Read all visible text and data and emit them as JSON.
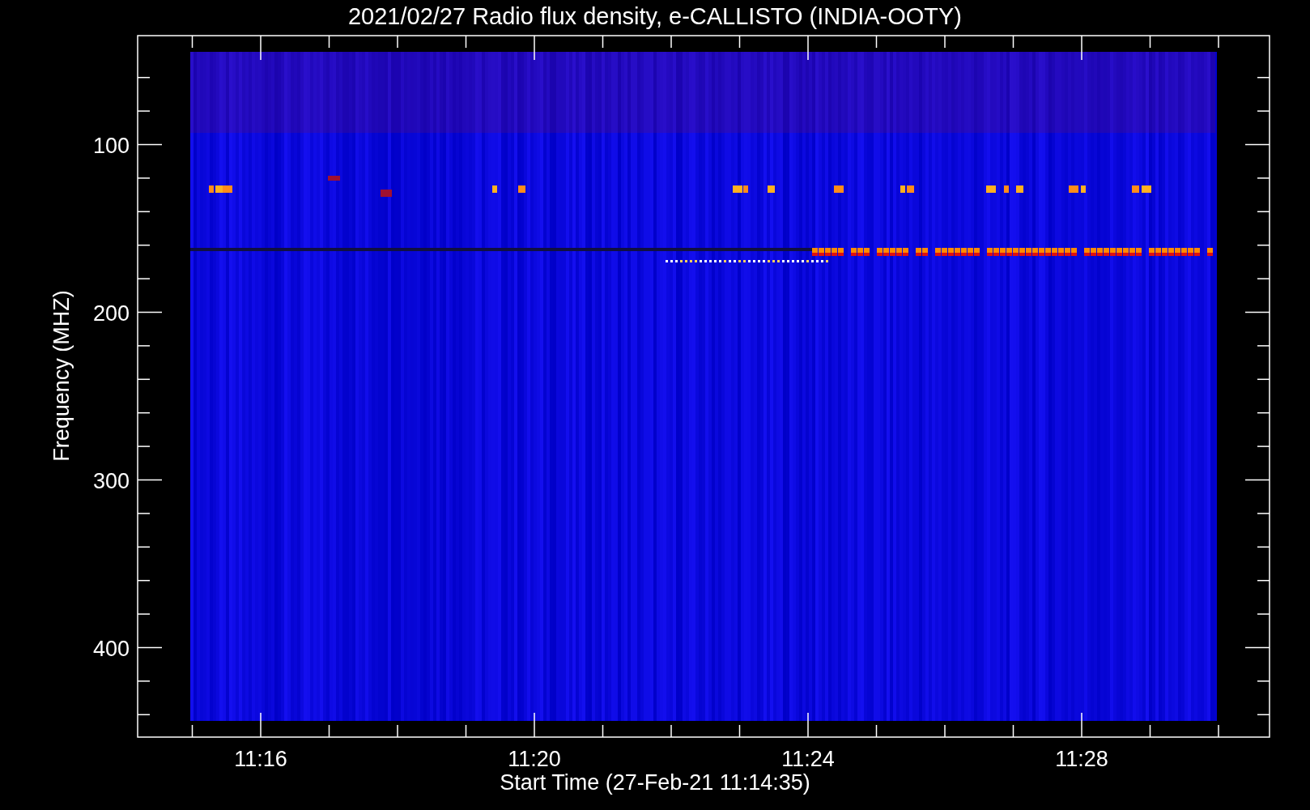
{
  "title": "2021/02/27  Radio flux density, e-CALLISTO (INDIA-OOTY)",
  "y_axis": {
    "label": "Frequency (MHZ)",
    "ticks": [
      "100",
      "200",
      "300",
      "400"
    ]
  },
  "x_axis": {
    "label": "Start Time (27-Feb-21 11:14:35)",
    "ticks": [
      "11:16",
      "11:20",
      "11:24",
      "11:28"
    ]
  }
}
